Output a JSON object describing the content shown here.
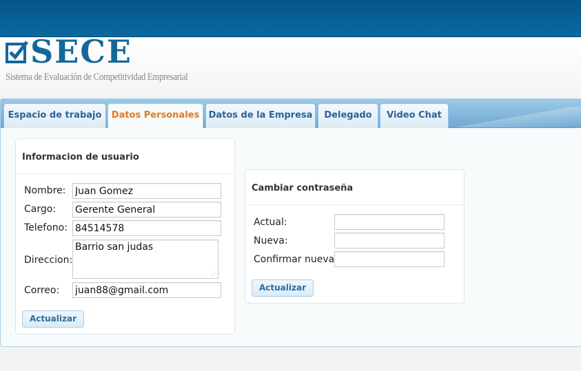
{
  "app": {
    "logo_text": "SECE",
    "logo_subtitle": "Sistema de Evaluación de Competitividad Empresarial"
  },
  "tabs": [
    {
      "label": "Espacio de trabajo",
      "active": false
    },
    {
      "label": "Datos Personales",
      "active": true
    },
    {
      "label": "Datos de la Empresa",
      "active": false
    },
    {
      "label": "Delegado",
      "active": false
    },
    {
      "label": "Video Chat",
      "active": false
    }
  ],
  "user_info": {
    "title": "Informacion de usuario",
    "fields": {
      "nombre": {
        "label": "Nombre:",
        "value": "Juan Gomez"
      },
      "cargo": {
        "label": "Cargo:",
        "value": "Gerente General"
      },
      "telefono": {
        "label": "Telefono:",
        "value": "84514578"
      },
      "direccion": {
        "label": "Direccion:",
        "value": "Barrio san judas"
      },
      "correo": {
        "label": "Correo:",
        "value": "juan88@gmail.com"
      }
    },
    "submit_label": "Actualizar"
  },
  "password": {
    "title": "Cambiar contraseña",
    "fields": {
      "actual": {
        "label": "Actual:",
        "value": ""
      },
      "nueva": {
        "label": "Nueva:",
        "value": ""
      },
      "confirmar": {
        "label": "Confirmar nueva:",
        "value": ""
      }
    },
    "submit_label": "Actualizar"
  },
  "colors": {
    "topbar": "#05558a",
    "brand": "#14679a",
    "active_tab_text": "#e07a1e",
    "tab_text": "#2a6496"
  }
}
